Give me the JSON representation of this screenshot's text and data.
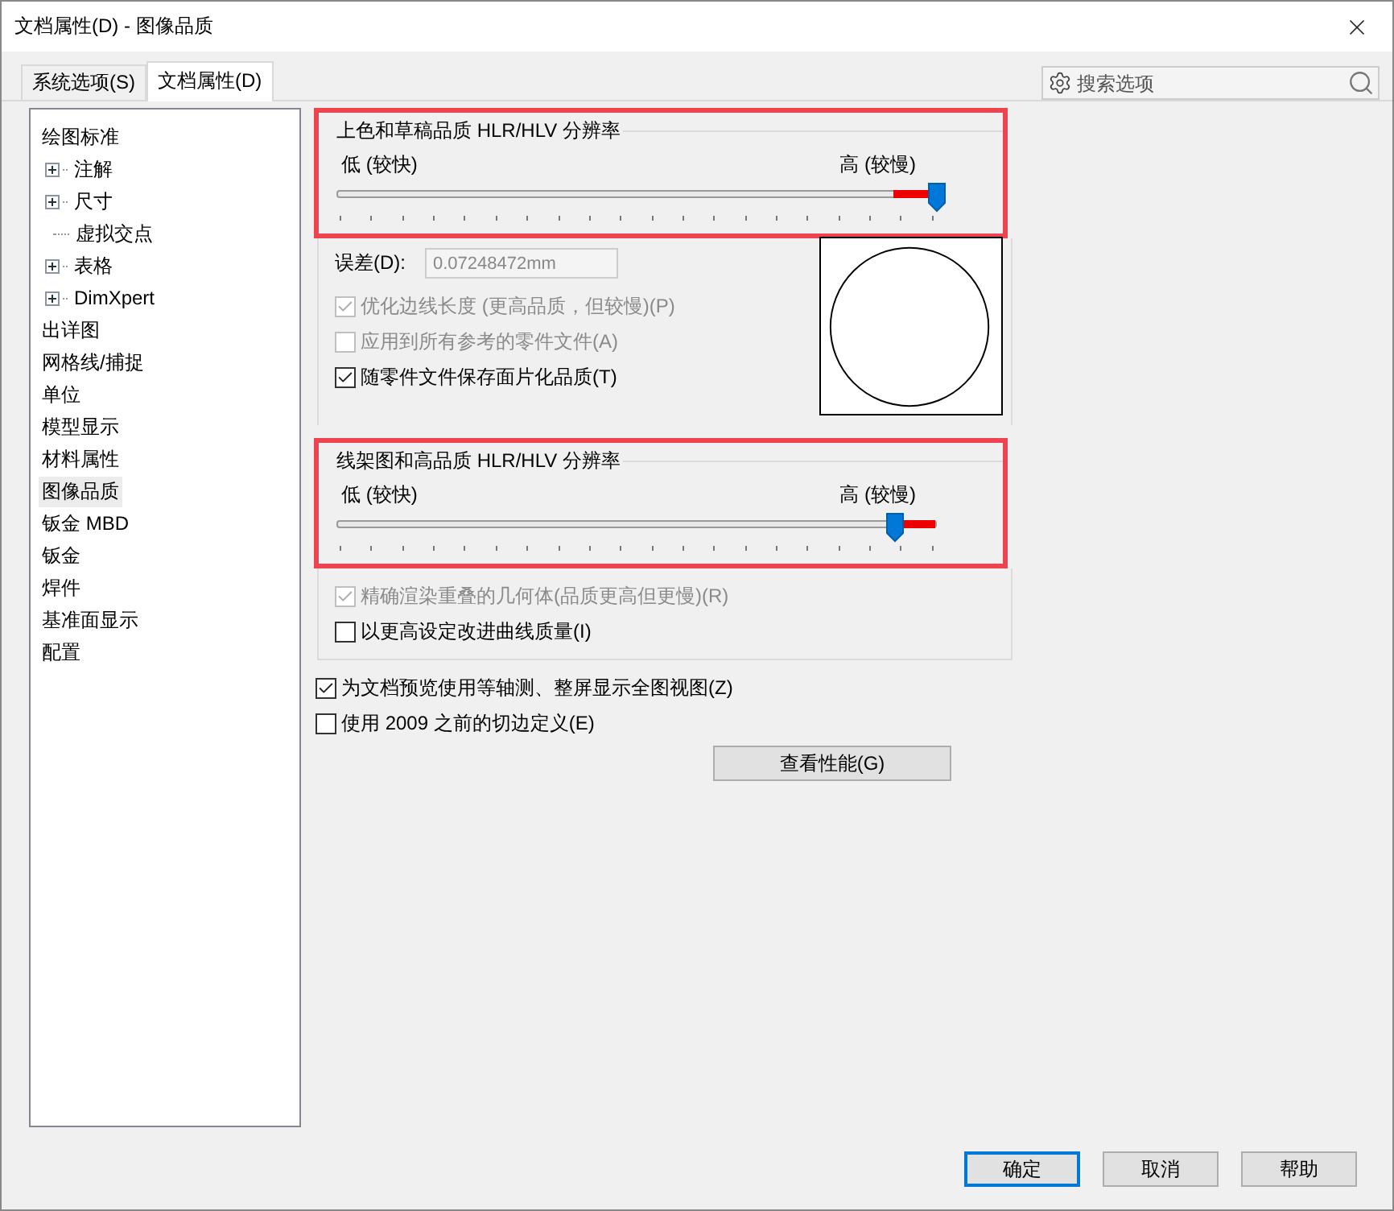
{
  "window": {
    "title": "文档属性(D) - 图像品质"
  },
  "tabs": [
    {
      "label": "系统选项(S)",
      "selected": false
    },
    {
      "label": "文档属性(D)",
      "selected": true
    }
  ],
  "search": {
    "placeholder": "搜索选项"
  },
  "tree": [
    {
      "label": "绘图标准",
      "selected": false,
      "children": [
        {
          "label": "注解",
          "selected": false,
          "expandable": true
        },
        {
          "label": "尺寸",
          "selected": false,
          "expandable": true
        },
        {
          "label": "虚拟交点",
          "selected": false,
          "expandable": false
        },
        {
          "label": "表格",
          "selected": false,
          "expandable": true
        },
        {
          "label": "DimXpert",
          "selected": false,
          "expandable": true
        }
      ]
    },
    {
      "label": "出详图",
      "selected": false
    },
    {
      "label": "网格线/捕捉",
      "selected": false
    },
    {
      "label": "单位",
      "selected": false
    },
    {
      "label": "模型显示",
      "selected": false
    },
    {
      "label": "材料属性",
      "selected": false
    },
    {
      "label": "图像品质",
      "selected": true
    },
    {
      "label": "钣金 MBD",
      "selected": false
    },
    {
      "label": "钣金",
      "selected": false
    },
    {
      "label": "焊件",
      "selected": false
    },
    {
      "label": "基准面显示",
      "selected": false
    },
    {
      "label": "配置",
      "selected": false
    }
  ],
  "shaded_group": {
    "title": "上色和草稿品质 HLR/HLV 分辨率",
    "highlighted": true,
    "slider": {
      "low_label": "低 (较快)",
      "high_label": "高 (较慢)",
      "level": 1.0
    },
    "tolerance": {
      "label": "误差(D):",
      "value": "0.07248472mm",
      "disabled": true
    },
    "checkboxes": [
      {
        "label": "优化边线长度 (更高品质，但较慢)(P)",
        "checked": true,
        "disabled": true
      },
      {
        "label": "应用到所有参考的零件文件(A)",
        "checked": false,
        "disabled": true
      },
      {
        "label": "随零件文件保存面片化品质(T)",
        "checked": true,
        "disabled": false
      }
    ]
  },
  "wireframe_group": {
    "title": "线架图和高品质 HLR/HLV 分辨率",
    "highlighted": true,
    "slider": {
      "low_label": "低 (较快)",
      "high_label": "高 (较慢)",
      "level": 0.93
    },
    "checkboxes": [
      {
        "label": "精确渲染重叠的几何体(品质更高但更慢)(R)",
        "checked": true,
        "disabled": true
      },
      {
        "label": "以更高设定改进曲线质量(I)",
        "checked": false,
        "disabled": false
      }
    ]
  },
  "options": [
    {
      "label": "为文档预览使用等轴测、整屏显示全图视图(Z)",
      "checked": true,
      "disabled": false
    },
    {
      "label": "使用 2009 之前的切边定义(E)",
      "checked": false,
      "disabled": false
    }
  ],
  "performance_button": "查看性能(G)",
  "buttons": [
    {
      "label": "确定",
      "default": true
    },
    {
      "label": "取消",
      "default": false
    },
    {
      "label": "帮助",
      "default": false
    }
  ]
}
